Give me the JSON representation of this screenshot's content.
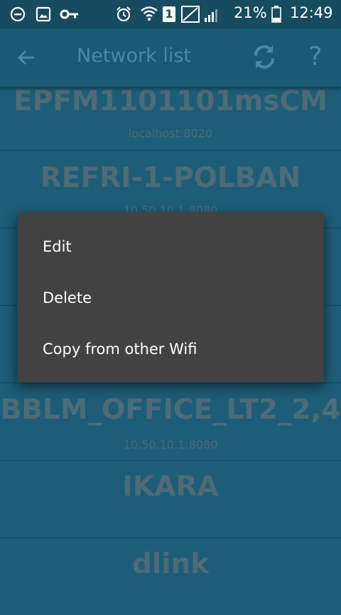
{
  "status_bar": {
    "battery_percent": "21%",
    "time": "12:49",
    "sim_badge": "1",
    "icons": [
      "do-not-disturb-icon",
      "image-icon",
      "vpn-key-icon",
      "alarm-icon",
      "wifi-icon",
      "sim-icon",
      "signal-icon",
      "battery-icon"
    ]
  },
  "app_bar": {
    "title": "Network list",
    "help_label": "?"
  },
  "networks": [
    {
      "name": "EPFM1101101msCM",
      "address": "localhost:8020"
    },
    {
      "name": "REFRI-1-POLBAN",
      "address": "10.50.10.1:8080"
    },
    {
      "name": "BBLM_OFFICE_LT2_2,4",
      "address": "10.50.10.1:8080"
    },
    {
      "name": "IKARA",
      "address": ""
    },
    {
      "name": "dlink",
      "address": ""
    }
  ],
  "context_menu": {
    "items": [
      "Edit",
      "Delete",
      "Copy from other Wifi"
    ]
  },
  "colors": {
    "background": "#1d5d78",
    "app_bar": "#195a74",
    "list_text": "#4d6b78",
    "menu_bg": "#424242"
  }
}
